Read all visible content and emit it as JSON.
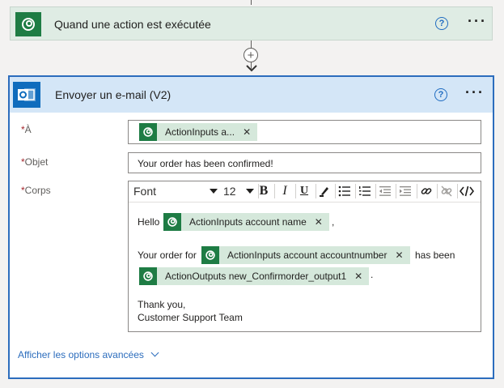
{
  "trigger": {
    "title": "Quand une action est exécutée",
    "help_icon": "?",
    "more_icon": "···"
  },
  "connector": {
    "plus_icon": "+"
  },
  "action": {
    "title": "Envoyer un e-mail (V2)",
    "help_icon": "?",
    "more_icon": "···",
    "fields": {
      "to": {
        "required_mark": "*",
        "label": "À",
        "token": "ActionInputs a..."
      },
      "subject": {
        "required_mark": "*",
        "label": "Objet",
        "value": "Your order has been confirmed!"
      },
      "body": {
        "required_mark": "*",
        "label": "Corps",
        "toolbar": {
          "font": "Font",
          "size": "12",
          "bold": "B",
          "italic": "I",
          "underline": "U"
        },
        "content": {
          "hello": "Hello",
          "token_account_name": "ActionInputs account name",
          "comma": ",",
          "your_order_for": "Your order for",
          "token_account_number": "ActionInputs account accountnumber",
          "has_been": "has been",
          "token_output": "ActionOutputs new_Confirmorder_output1",
          "period": ".",
          "thank_you": "Thank you,",
          "signature": "Customer Support Team"
        }
      }
    },
    "advanced_link": "Afficher les options avancées"
  },
  "colors": {
    "dataverse_green": "#1e7c44",
    "outlook_blue": "#0f6cbd",
    "accent_blue": "#2c6dbd",
    "token_bg": "#d5e8db"
  }
}
